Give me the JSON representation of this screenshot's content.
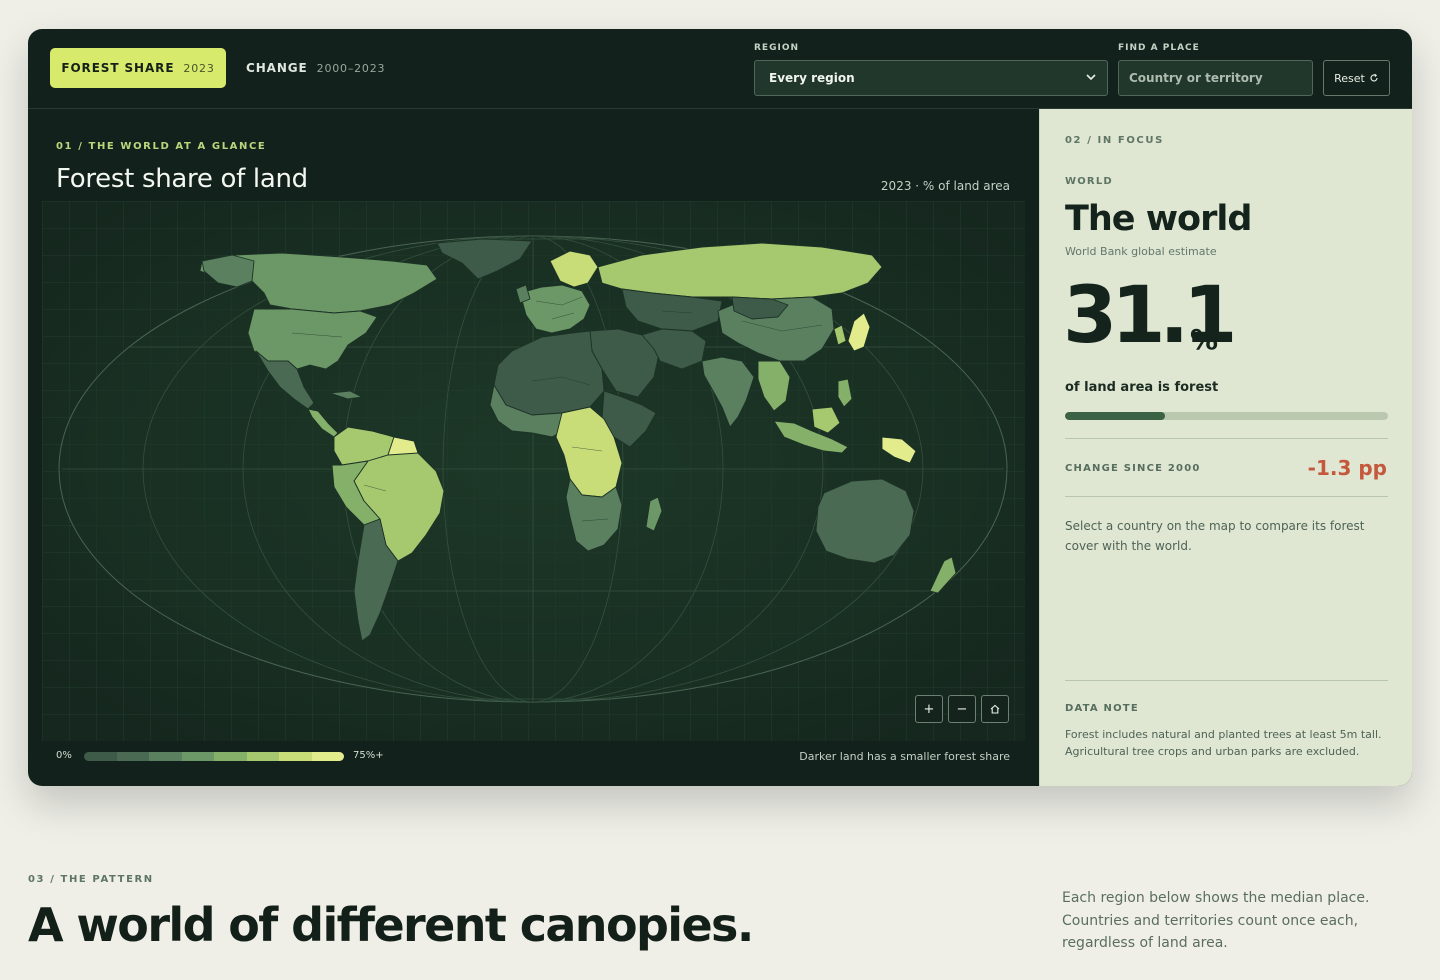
{
  "header": {
    "tab_active": {
      "label": "FOREST SHARE",
      "year": "2023"
    },
    "tab_inactive": {
      "label": "CHANGE",
      "range": "2000–2023"
    },
    "region": {
      "label": "REGION",
      "value": "Every region"
    },
    "find": {
      "label": "FIND A PLACE",
      "placeholder": "Country or territory"
    },
    "reset_label": "Reset",
    "reset_icon": "refresh-icon"
  },
  "map_panel": {
    "kicker": "01 / THE WORLD AT A GLANCE",
    "title": "Forest share of land",
    "subtitle": "2023 · % of land area",
    "zoom": {
      "in": "+",
      "out": "−",
      "home_icon": "home-icon"
    },
    "legend": {
      "min": "0%",
      "max": "75%+",
      "note": "Darker land has a smaller forest share",
      "colors": [
        "#3e5a48",
        "#4a6a53",
        "#5a8060",
        "#6b9866",
        "#84b06a",
        "#a6c86f",
        "#c8dd78",
        "#e3ec8c"
      ]
    },
    "map_data": {
      "projection": "Robinson",
      "metric": "Forest share of land (%)",
      "year": 2023,
      "fill_scale_percent": [
        0,
        75
      ]
    }
  },
  "focus": {
    "kicker": "02 / IN FOCUS",
    "region_tag": "WORLD",
    "name": "The world",
    "source": "World Bank global estimate",
    "value": "31.1",
    "unit": "%",
    "caption": "of land area is forest",
    "share_fraction": 0.311,
    "change_label": "CHANGE SINCE 2000",
    "change_value": "-1.3 pp",
    "help": "Select a country on the map to compare its forest cover with the world.",
    "note_label": "DATA NOTE",
    "note": "Forest includes natural and planted trees at least 5m tall. Agricultural tree crops and urban parks are excluded."
  },
  "section3": {
    "kicker": "03 / THE PATTERN",
    "title": "A world of different canopies.",
    "text": "Each region below shows the median place. Countries and territories count once each, regardless of land area."
  },
  "colors": {
    "panel_dark": "#12211b",
    "accent_lime": "#d8ea6c",
    "focus_bg": "#dfe7d3",
    "negative": "#c4573c"
  }
}
